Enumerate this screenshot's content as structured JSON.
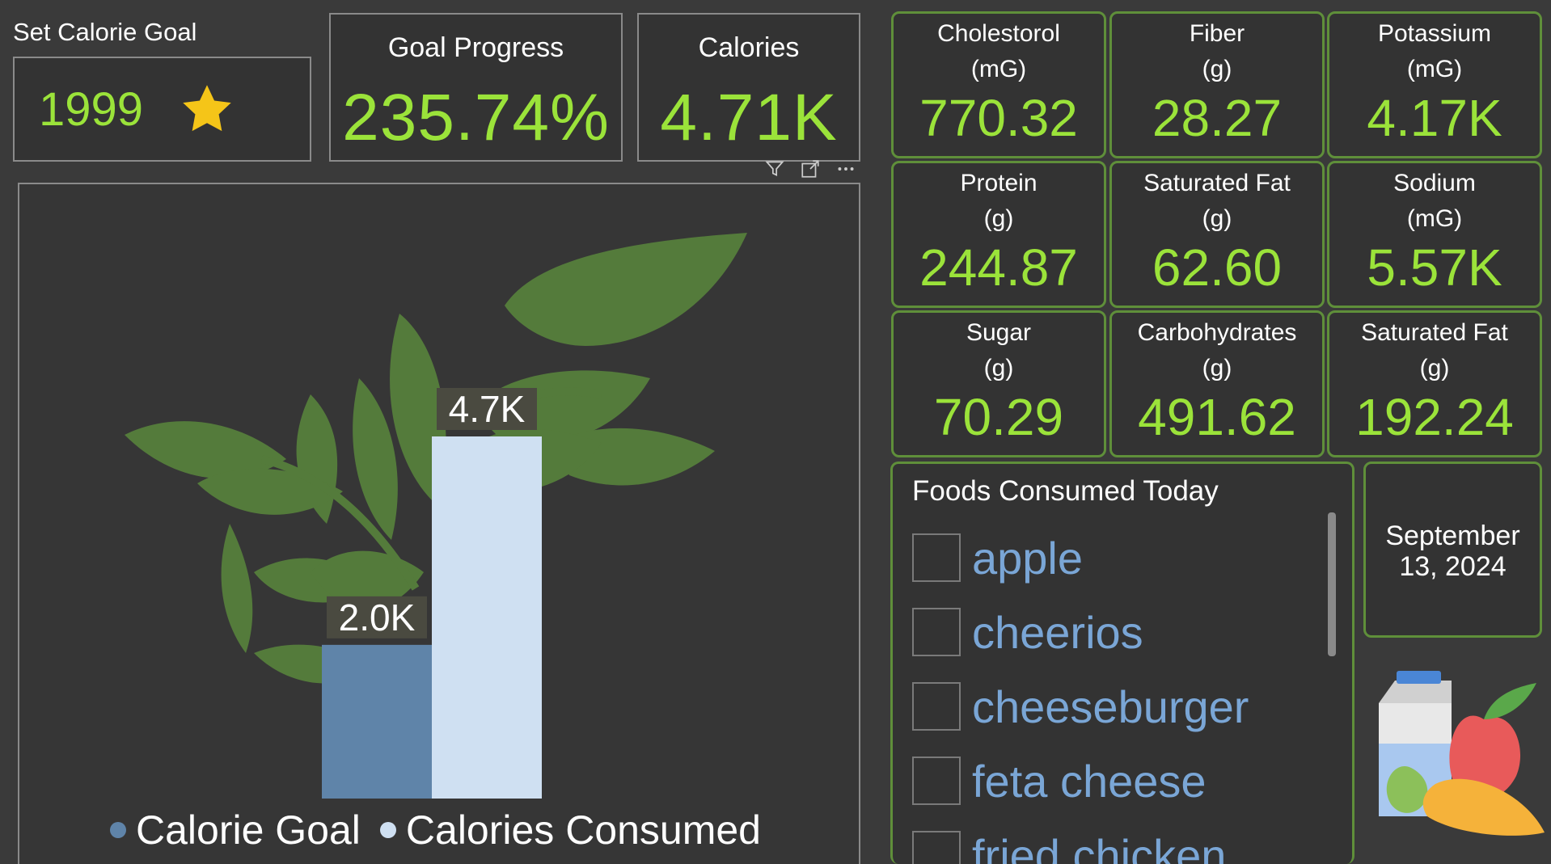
{
  "calorie_goal": {
    "title": "Set Calorie Goal",
    "value": "1999",
    "icon": "star-icon"
  },
  "kpis": {
    "goal_progress": {
      "label": "Goal Progress",
      "value": "235.74%"
    },
    "calories": {
      "label": "Calories",
      "value": "4.71K"
    }
  },
  "visual_header": {
    "icons": [
      "filter-icon",
      "focus-mode-icon",
      "more-options-icon"
    ]
  },
  "chart_data": {
    "type": "bar",
    "categories": [
      "Calorie Goal",
      "Calories Consumed"
    ],
    "values": [
      1999,
      4710
    ],
    "data_labels": [
      "2.0K",
      "4.7K"
    ],
    "legend": [
      {
        "name": "Calorie Goal",
        "color": "#5f84a9"
      },
      {
        "name": "Calories Consumed",
        "color": "#cfe0f2"
      }
    ],
    "legend_position": "bottom",
    "grid": false,
    "ylim": [
      0,
      4710
    ]
  },
  "nutrients": [
    {
      "name": "Cholestorol",
      "unit": "(mG)",
      "value": "770.32"
    },
    {
      "name": "Fiber",
      "unit": "(g)",
      "value": "28.27"
    },
    {
      "name": "Potassium",
      "unit": "(mG)",
      "value": "4.17K"
    },
    {
      "name": "Protein",
      "unit": "(g)",
      "value": "244.87"
    },
    {
      "name": "Saturated Fat",
      "unit": "(g)",
      "value": "62.60"
    },
    {
      "name": "Sodium",
      "unit": "(mG)",
      "value": "5.57K"
    },
    {
      "name": "Sugar",
      "unit": "(g)",
      "value": "70.29"
    },
    {
      "name": "Carbohydrates",
      "unit": "(g)",
      "value": "491.62"
    },
    {
      "name": "Saturated Fat",
      "unit": "(g)",
      "value": "192.24"
    }
  ],
  "foods": {
    "title": "Foods Consumed Today",
    "items": [
      "apple",
      "cheerios",
      "cheeseburger",
      "feta cheese",
      "fried chicken"
    ]
  },
  "date": {
    "line1": "September",
    "line2": "13, 2024"
  },
  "colors": {
    "accent": "#9be33a",
    "border_green": "#5f8f3a",
    "food_text": "#7aa6d6",
    "background": "#3a3a3a"
  }
}
